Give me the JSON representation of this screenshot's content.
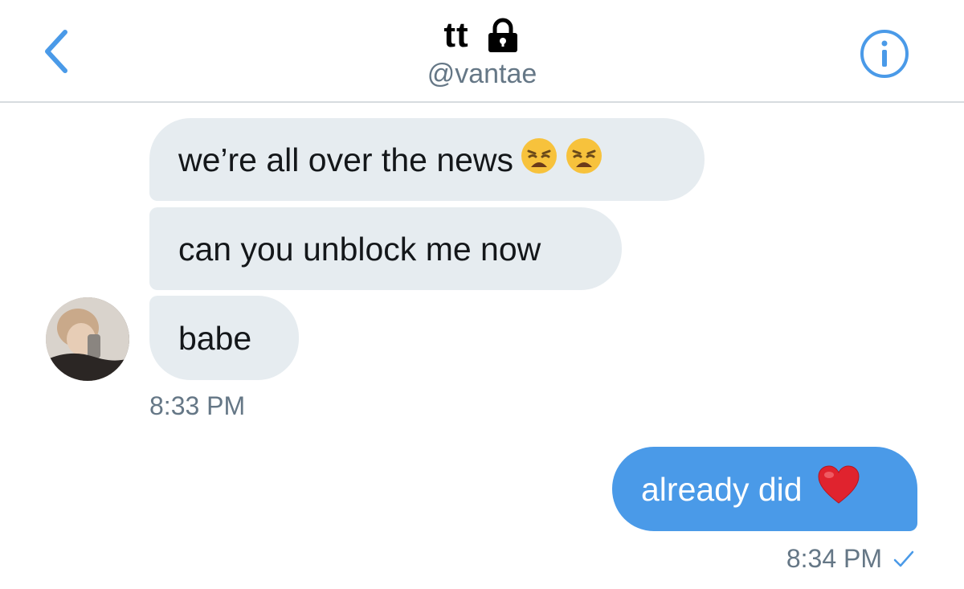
{
  "header": {
    "title": "tt",
    "handle": "@vantae",
    "back_icon": "chevron-left-icon",
    "lock_icon": "lock-icon",
    "info_icon": "info-icon"
  },
  "colors": {
    "accent": "#4a9ae8",
    "incoming_bubble": "#e6ecf0",
    "muted_text": "#657786"
  },
  "messages": {
    "incoming": [
      {
        "text": "we’re all over the news",
        "emoji": [
          "weary-face",
          "weary-face"
        ]
      },
      {
        "text": "can you unblock me now"
      },
      {
        "text": "babe"
      }
    ],
    "incoming_time": "8:33 PM",
    "outgoing": [
      {
        "text": "already did",
        "emoji": [
          "red-heart"
        ]
      }
    ],
    "outgoing_time": "8:34 PM",
    "outgoing_status_icon": "checkmark-icon"
  }
}
